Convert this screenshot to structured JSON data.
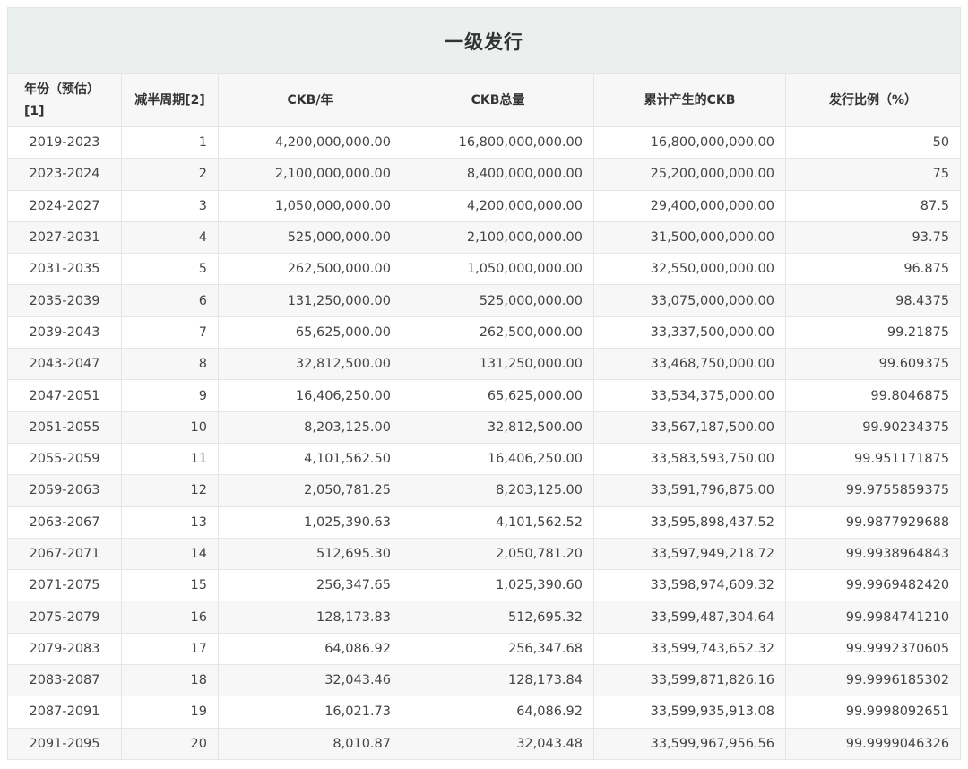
{
  "title": "一级发行",
  "columns": [
    "年份（预估）[1]",
    "减半周期[2]",
    "CKB/年",
    "CKB总量",
    "累计产生的CKB",
    "发行比例（%）"
  ],
  "rows": [
    [
      "2019-2023",
      "1",
      "4,200,000,000.00",
      "16,800,000,000.00",
      "16,800,000,000.00",
      "50"
    ],
    [
      "2023-2024",
      "2",
      "2,100,000,000.00",
      "8,400,000,000.00",
      "25,200,000,000.00",
      "75"
    ],
    [
      "2024-2027",
      "3",
      "1,050,000,000.00",
      "4,200,000,000.00",
      "29,400,000,000.00",
      "87.5"
    ],
    [
      "2027-2031",
      "4",
      "525,000,000.00",
      "2,100,000,000.00",
      "31,500,000,000.00",
      "93.75"
    ],
    [
      "2031-2035",
      "5",
      "262,500,000.00",
      "1,050,000,000.00",
      "32,550,000,000.00",
      "96.875"
    ],
    [
      "2035-2039",
      "6",
      "131,250,000.00",
      "525,000,000.00",
      "33,075,000,000.00",
      "98.4375"
    ],
    [
      "2039-2043",
      "7",
      "65,625,000.00",
      "262,500,000.00",
      "33,337,500,000.00",
      "99.21875"
    ],
    [
      "2043-2047",
      "8",
      "32,812,500.00",
      "131,250,000.00",
      "33,468,750,000.00",
      "99.609375"
    ],
    [
      "2047-2051",
      "9",
      "16,406,250.00",
      "65,625,000.00",
      "33,534,375,000.00",
      "99.8046875"
    ],
    [
      "2051-2055",
      "10",
      "8,203,125.00",
      "32,812,500.00",
      "33,567,187,500.00",
      "99.90234375"
    ],
    [
      "2055-2059",
      "11",
      "4,101,562.50",
      "16,406,250.00",
      "33,583,593,750.00",
      "99.951171875"
    ],
    [
      "2059-2063",
      "12",
      "2,050,781.25",
      "8,203,125.00",
      "33,591,796,875.00",
      "99.9755859375"
    ],
    [
      "2063-2067",
      "13",
      "1,025,390.63",
      "4,101,562.52",
      "33,595,898,437.52",
      "99.9877929688"
    ],
    [
      "2067-2071",
      "14",
      "512,695.30",
      "2,050,781.20",
      "33,597,949,218.72",
      "99.9938964843"
    ],
    [
      "2071-2075",
      "15",
      "256,347.65",
      "1,025,390.60",
      "33,598,974,609.32",
      "99.9969482420"
    ],
    [
      "2075-2079",
      "16",
      "128,173.83",
      "512,695.32",
      "33,599,487,304.64",
      "99.9984741210"
    ],
    [
      "2079-2083",
      "17",
      "64,086.92",
      "256,347.68",
      "33,599,743,652.32",
      "99.9992370605"
    ],
    [
      "2083-2087",
      "18",
      "32,043.46",
      "128,173.84",
      "33,599,871,826.16",
      "99.9996185302"
    ],
    [
      "2087-2091",
      "19",
      "16,021.73",
      "64,086.92",
      "33,599,935,913.08",
      "99.9998092651"
    ],
    [
      "2091-2095",
      "20",
      "8,010.87",
      "32,043.48",
      "33,599,967,956.56",
      "99.9999046326"
    ]
  ]
}
